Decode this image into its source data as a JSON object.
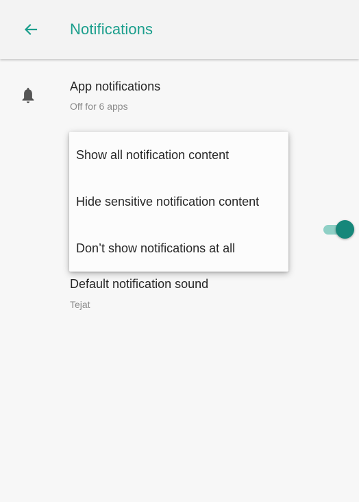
{
  "appbar": {
    "title": "Notifications",
    "back_icon": "arrow-left-icon"
  },
  "colors": {
    "accent": "#1a9e8c",
    "switch_thumb": "#16877a",
    "switch_track": "#8fd0c6"
  },
  "settings": {
    "app_notifications": {
      "title": "App notifications",
      "subtitle": "Off for 6 apps",
      "icon": "bell-icon"
    },
    "default_sound": {
      "title": "Default notification sound",
      "subtitle": "Tejat"
    },
    "toggle": {
      "on": true
    }
  },
  "menu": {
    "items": [
      {
        "label": "Show all notification content"
      },
      {
        "label": "Hide sensitive notification content"
      },
      {
        "label": "Don’t show notifications at all"
      }
    ]
  }
}
